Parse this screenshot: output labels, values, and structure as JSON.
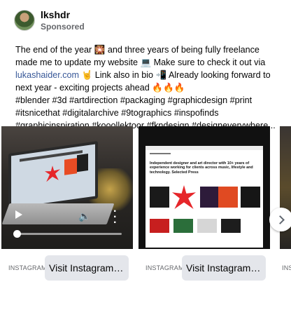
{
  "post": {
    "author": "lkshdr",
    "sponsored_label": "Sponsored",
    "caption_part1": "The end of the year 🎇 and three years of being fully freelance made me to update my website 💻 Make sure to check it out via ",
    "caption_link": "lukashaider.com",
    "caption_part2": " 🤘 Link also in bio 📲 Already looking forward to next year - exciting projects ahead 🔥🔥🔥",
    "hashtags": [
      "#blender #3d #artdirection #packaging #graphicdesign #print",
      "#itsnicethat #digitalarchive #9tographics #inspofinds",
      "#graphicinspiration #kooollektoor #fkndesign #designeverywhere..."
    ]
  },
  "carousel": {
    "cards": [
      {
        "media_type": "video",
        "domain": "INSTAGRAM.C...",
        "cta_label": "Visit Instagram profile",
        "progress": 0.0
      },
      {
        "media_type": "image",
        "domain": "INSTAGRAM.C...",
        "cta_label": "Visit Instagram profile",
        "site_headline": "Independent designer and art director with 10+ years of experience working for clients across music, lifestyle and technology. Selected Press"
      },
      {
        "media_type": "image",
        "domain": "INSTA"
      }
    ],
    "next_icon": "chevron-right-icon"
  },
  "colors": {
    "link": "#385898",
    "cta_bg": "#e4e6eb",
    "muted": "#65676b"
  }
}
